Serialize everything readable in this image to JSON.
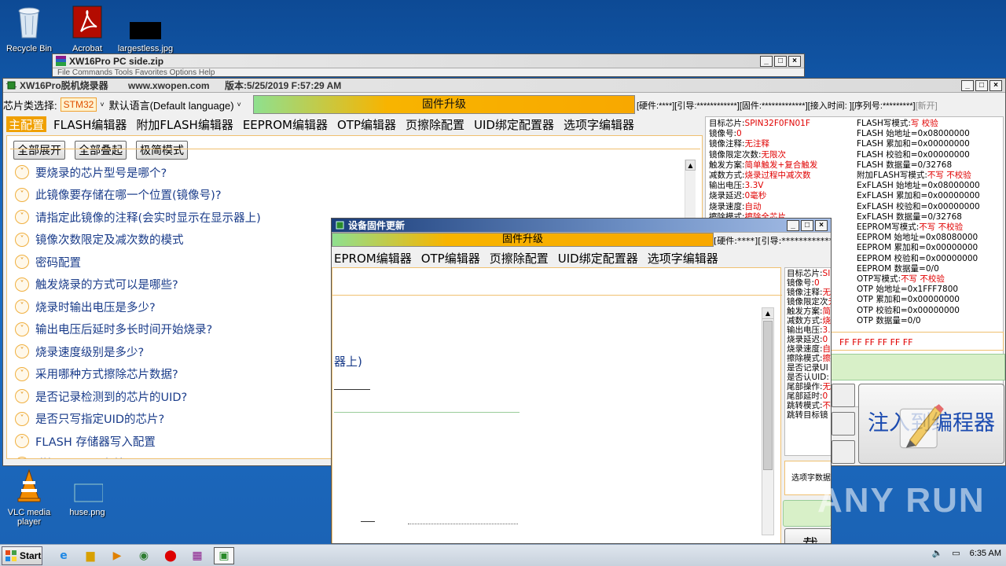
{
  "desktop": {
    "icons": [
      {
        "label": "Recycle Bin"
      },
      {
        "label": "Acrobat"
      },
      {
        "label": "largestless.jpg"
      },
      {
        "label": "VLC media player"
      },
      {
        "label": "huse.png"
      }
    ]
  },
  "zip_window": {
    "title": "XW16Pro PC side.zip",
    "menu": "File  Commands  Tools  Favorites  Options  Help"
  },
  "main_window": {
    "title": "XW16Pro脱机烧录器",
    "site": "www.xwopen.com",
    "version": "版本:5/25/2019 F:57:29 AM",
    "chip_label": "芯片类选择:",
    "chip_value": "STM32",
    "language": "默认语言(Default language)",
    "upgrade_label": "固件升级",
    "hwinfo": "[硬件:****][引导:************][固件:*************][接入时间: ][序列号:*********]",
    "hwinfo_new": "[新开]",
    "tabs": [
      "主配置",
      "FLASH编辑器",
      "附加FLASH编辑器",
      "EEPROM编辑器",
      "OTP编辑器",
      "页擦除配置",
      "UID绑定配置器",
      "选项字编辑器"
    ],
    "buttons": {
      "expand_all": "全部展开",
      "collapse_all": "全部叠起",
      "minimal_mode": "极简模式"
    },
    "questions": [
      "要烧录的芯片型号是哪个?",
      "此镜像要存储在哪一个位置(镜像号)?",
      "请指定此镜像的注释(会实时显示在显示器上)",
      "镜像次数限定及减次数的模式",
      "密码配置",
      "触发烧录的方式可以是哪些?",
      "烧录时输出电压是多少?",
      "输出电压后延时多长时间开始烧录?",
      "烧录速度级别是多少?",
      "采用哪种方式擦除芯片数据?",
      "是否记录检测到的芯片的UID?",
      "是否只写指定UID的芯片?",
      "FLASH 存储器写入配置",
      "附加 FLASH 存储器写入配置"
    ],
    "info_left": [
      {
        "k": "目标芯片:",
        "v": "SPIN32F0FN01F"
      },
      {
        "k": "镜像号:",
        "v": "0"
      },
      {
        "k": "镜像注释:",
        "v": "无注释"
      },
      {
        "k": "镜像限定次数:",
        "v": "无限次"
      },
      {
        "k": "触发方案:",
        "v": "简单触发+复合触发"
      },
      {
        "k": "减数方式:",
        "v": "烧录过程中减次数"
      },
      {
        "k": "输出电压:",
        "v": "3.3V"
      },
      {
        "k": "烧录延迟:",
        "v": "0毫秒"
      },
      {
        "k": "烧录速度:",
        "v": "自动"
      },
      {
        "k": "擦除模式:",
        "v": "擦除全芯片"
      }
    ],
    "info_right": [
      {
        "k": "FLASH写模式:",
        "v": "写 校验"
      },
      {
        "k": "FLASH 始地址=0x08000000",
        "v": ""
      },
      {
        "k": "FLASH 累加和=0x00000000",
        "v": ""
      },
      {
        "k": "FLASH 校验和=0x00000000",
        "v": ""
      },
      {
        "k": "FLASH 数据量=0/32768",
        "v": ""
      },
      {
        "k": "附加FLASH写模式:",
        "v": "不写 不校验"
      },
      {
        "k": "ExFLASH 始地址=0x08000000",
        "v": ""
      },
      {
        "k": "ExFLASH 累加和=0x00000000",
        "v": ""
      },
      {
        "k": "ExFLASH 校验和=0x00000000",
        "v": ""
      },
      {
        "k": "ExFLASH 数据量=0/32768",
        "v": ""
      },
      {
        "k": "EEPROM写模式:",
        "v": "不写 不校验"
      },
      {
        "k": "EEPROM 始地址=0x08080000",
        "v": ""
      },
      {
        "k": "EEPROM 累加和=0x00000000",
        "v": ""
      },
      {
        "k": "EEPROM 校验和=0x00000000",
        "v": ""
      },
      {
        "k": "EEPROM 数据量=0/0",
        "v": ""
      },
      {
        "k": "OTP写模式:",
        "v": "不写 不校验"
      },
      {
        "k": "OTP 始地址=0x1FFF7800",
        "v": ""
      },
      {
        "k": "OTP 累加和=0x00000000",
        "v": ""
      },
      {
        "k": "OTP 校验和=0x00000000",
        "v": ""
      },
      {
        "k": "OTP 数据量=0/0",
        "v": ""
      }
    ],
    "hex_bytes": "FF FF FF FF FF FF",
    "inject_label": "注入到编程器"
  },
  "overlay_window": {
    "title": "设备固件更新",
    "upgrade_label": "固件升级",
    "hwinfo": "[硬件:****][引导:************",
    "tabs": [
      "EPROM编辑器",
      "OTP编辑器",
      "页擦除配置",
      "UID绑定配置器",
      "选项字编辑器"
    ],
    "fragment": "器上)",
    "info": [
      "目标芯片:",
      "镜像号:",
      "镜像注释:",
      "镜像限定次",
      "触发方案:",
      "减数方式:",
      "输出电压:",
      "烧录延迟:",
      "烧录速度:",
      "擦除模式:",
      "是否记录UI",
      "是否认UID:",
      "尾部操作:",
      "尾部延时:",
      "跳转模式:",
      "跳转目标镜"
    ],
    "info_vals": [
      "SI",
      "0",
      "无",
      "无",
      "简",
      "烧",
      "3.",
      "0",
      "自",
      "擦",
      "",
      "",
      "无",
      "0",
      "不",
      ""
    ],
    "option_label": "选项字数据",
    "load_label": "载入"
  },
  "taskbar": {
    "start_label": "Start",
    "time": "6:35 AM"
  },
  "watermark": "ANY RUN"
}
